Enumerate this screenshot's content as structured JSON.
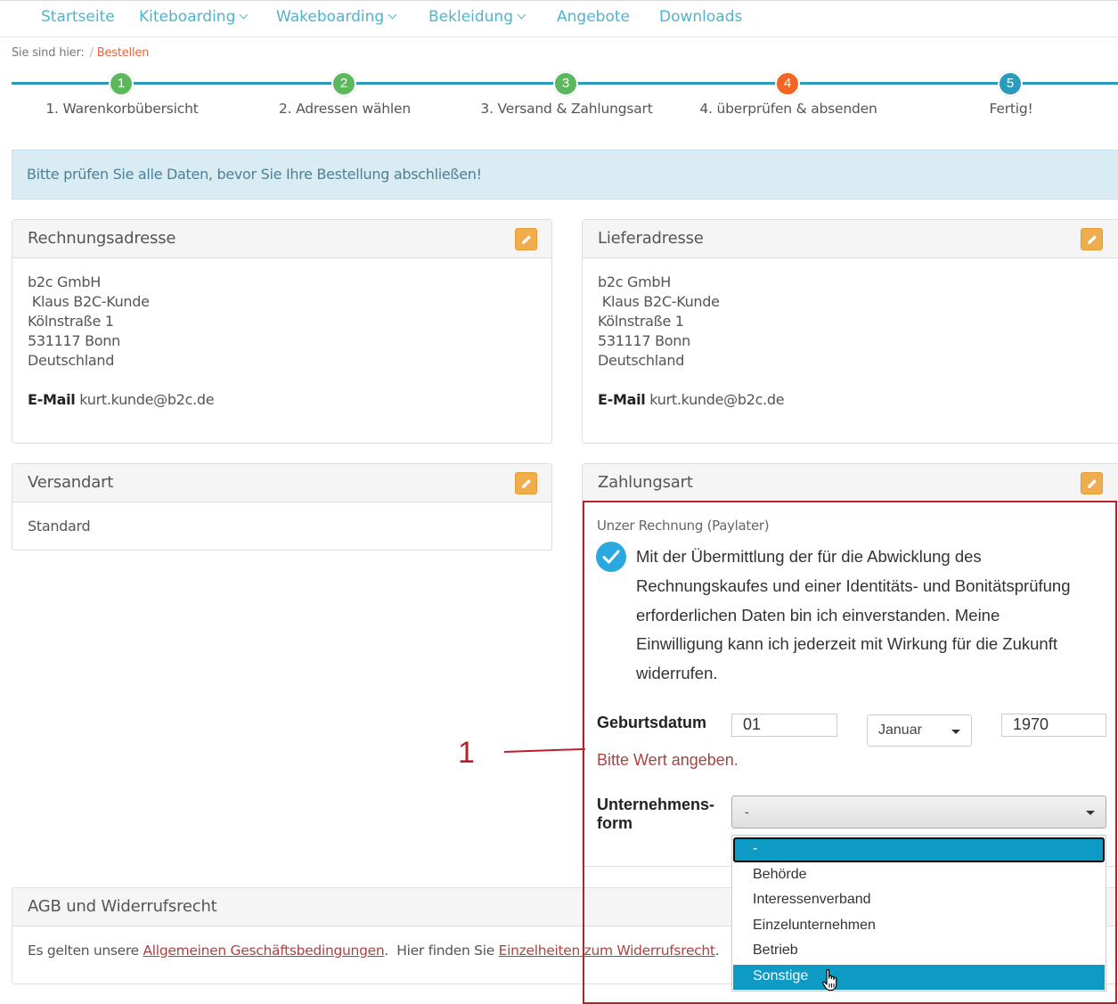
{
  "nav": {
    "items": [
      {
        "label": "Startseite",
        "dropdown": false
      },
      {
        "label": "Kiteboarding",
        "dropdown": true
      },
      {
        "label": "Wakeboarding",
        "dropdown": true
      },
      {
        "label": "Bekleidung",
        "dropdown": true
      },
      {
        "label": "Angebote",
        "dropdown": false
      },
      {
        "label": "Downloads",
        "dropdown": false
      }
    ]
  },
  "breadcrumb": {
    "prefix": "Sie sind hier:",
    "separator": "/",
    "current": "Bestellen"
  },
  "steps": [
    {
      "number": "1",
      "label": "1. Warenkorbübersicht",
      "state": "done",
      "color": "#5cb85c"
    },
    {
      "number": "2",
      "label": "2. Adressen wählen",
      "state": "done",
      "color": "#5cb85c"
    },
    {
      "number": "3",
      "label": "3. Versand & Zahlungsart",
      "state": "done",
      "color": "#5cb85c"
    },
    {
      "number": "4",
      "label": "4. überprüfen & absenden",
      "state": "active",
      "color": "#f26522"
    },
    {
      "number": "5",
      "label": "Fertig!",
      "state": "pending",
      "color": "#2a9bbd"
    }
  ],
  "alert": {
    "text": "Bitte prüfen Sie alle Daten, bevor Sie Ihre Bestellung abschließen!"
  },
  "billing": {
    "title": "Rechnungsadresse",
    "company": "b2c GmbH",
    "name": " Klaus B2C-Kunde",
    "street": "Kölnstraße 1",
    "city": "531117 Bonn",
    "country": "Deutschland",
    "email_label": "E-Mail",
    "email": "kurt.kunde@b2c.de"
  },
  "delivery": {
    "title": "Lieferadresse",
    "company": "b2c GmbH",
    "name": " Klaus B2C-Kunde",
    "street": "Kölnstraße 1",
    "city": "531117 Bonn",
    "country": "Deutschland",
    "email_label": "E-Mail",
    "email": "kurt.kunde@b2c.de"
  },
  "shipping": {
    "title": "Versandart",
    "value": "Standard"
  },
  "payment": {
    "title": "Zahlungsart",
    "method": "Unzer Rechnung (Paylater)",
    "consent_lines": [
      "Mit der Übermittlung der für die Abwicklung des",
      "Rechnungskaufes und einer Identitäts- und Bonitätsprüfung",
      "erforderlichen Daten bin ich einverstanden. Meine",
      "Einwilligung kann ich jederzeit mit Wirkung für die Zukunft",
      "widerrufen."
    ],
    "birthdate_label": "Geburtsdatum",
    "day": "01",
    "month": "Januar",
    "year": "1970",
    "error": "Bitte Wert angeben.",
    "company_form_label_1": "Unternehmens-",
    "company_form_label_2": "form",
    "company_form_value": "-",
    "company_form_options": [
      "-",
      "Behörde",
      "Interessenverband",
      "Einzelunternehmen",
      "Betrieb",
      "Sonstige"
    ],
    "focused_option": "-",
    "hovered_option": "Sonstige"
  },
  "terms": {
    "title": "AGB und Widerrufsrecht",
    "text_1": "Es gelten unsere ",
    "link_1": "Allgemeinen Geschäftsbedingungen",
    "text_2": ".  Hier finden Sie ",
    "link_2": "Einzelheiten zum Widerrufsrecht",
    "text_3": "."
  },
  "annotation": {
    "number": "1",
    "color": "#b8202a"
  },
  "colors": {
    "accent": "#4fb3cf",
    "step_line": "#2a9bbd",
    "edit_button": "#f0ad4e",
    "error": "#a94442",
    "highlight": "#0d9ac4"
  }
}
